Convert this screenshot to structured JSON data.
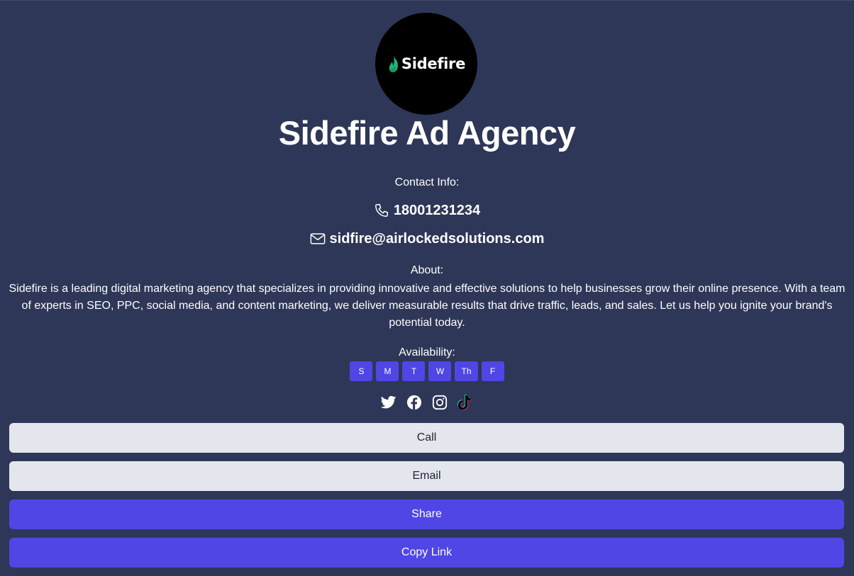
{
  "profile": {
    "logo_text": "Sidefire",
    "name": "Sidefire Ad Agency"
  },
  "contact": {
    "heading": "Contact Info:",
    "phone": "18001231234",
    "email": "sidfire@airlockedsolutions.com"
  },
  "about": {
    "heading": "About:",
    "text": "Sidefire is a leading digital marketing agency that specializes in providing innovative and effective solutions to help businesses grow their online presence. With a team of experts in SEO, PPC, social media, and content marketing, we deliver measurable results that drive traffic, leads, and sales. Let us help you ignite your brand's potential today."
  },
  "availability": {
    "heading": "Availability:",
    "days": [
      "S",
      "M",
      "T",
      "W",
      "Th",
      "F"
    ]
  },
  "socials": [
    "twitter-icon",
    "facebook-icon",
    "instagram-icon",
    "tiktok-icon"
  ],
  "buttons": {
    "call": "Call",
    "email": "Email",
    "share": "Share",
    "copy_link": "Copy Link"
  },
  "colors": {
    "background": "#2e3757",
    "accent": "#4f46e5",
    "light_button": "#e3e6ed",
    "logo_flame": "#1fb37a"
  }
}
